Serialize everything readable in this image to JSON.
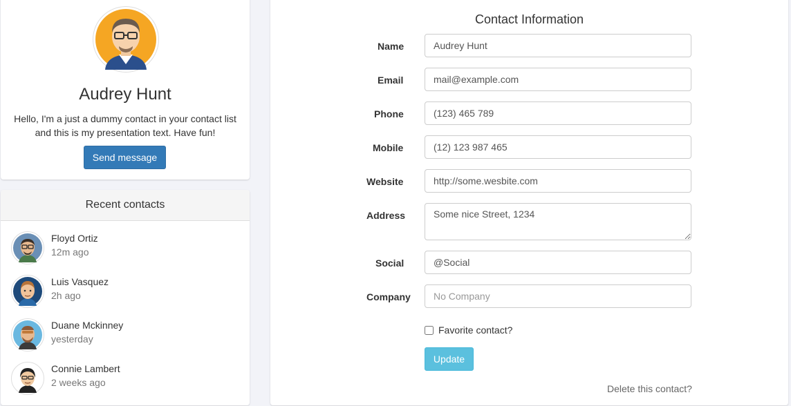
{
  "profile": {
    "name": "Audrey Hunt",
    "text": "Hello, I'm a just a dummy contact in your contact list and this is my presentation text. Have fun!",
    "button_label": "Send message",
    "avatar": "male-avatar-glasses-icon"
  },
  "recent": {
    "title": "Recent contacts",
    "contacts": [
      {
        "name": "Floyd Ortiz",
        "time": "12m ago",
        "avatar": "avatar-glasses-icon"
      },
      {
        "name": "Luis Vasquez",
        "time": "2h ago",
        "avatar": "avatar-headphones-icon"
      },
      {
        "name": "Duane Mckinney",
        "time": "yesterday",
        "avatar": "avatar-beard-icon"
      },
      {
        "name": "Connie Lambert",
        "time": "2 weeks ago",
        "avatar": "avatar-dark-hair-icon"
      }
    ]
  },
  "form": {
    "title": "Contact Information",
    "fields": {
      "name": {
        "label": "Name",
        "value": "Audrey Hunt"
      },
      "email": {
        "label": "Email",
        "value": "mail@example.com"
      },
      "phone": {
        "label": "Phone",
        "value": "(123) 465 789"
      },
      "mobile": {
        "label": "Mobile",
        "value": "(12) 123 987 465"
      },
      "website": {
        "label": "Website",
        "value": "http://some.wesbite.com"
      },
      "address": {
        "label": "Address",
        "value": "Some nice Street, 1234"
      },
      "social": {
        "label": "Social",
        "value": "@Social"
      },
      "company": {
        "label": "Company",
        "value": "",
        "placeholder": "No Company"
      }
    },
    "favorite_label": "Favorite contact?",
    "favorite_checked": false,
    "update_label": "Update",
    "delete_label": "Delete this contact?"
  },
  "colors": {
    "primary": "#337ab7",
    "info": "#5bc0de",
    "background": "#f2f3f8"
  }
}
